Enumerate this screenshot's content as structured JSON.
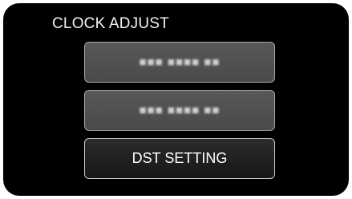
{
  "screen": {
    "title": "CLOCK ADJUST"
  },
  "menu": {
    "items": [
      {
        "label": "",
        "label_legible": false
      },
      {
        "label": "",
        "label_legible": false
      },
      {
        "label": "DST SETTING",
        "label_legible": true
      }
    ]
  },
  "colors": {
    "background": "#000000",
    "button_fill": "#525252",
    "button_border": "#a6a6a6",
    "text": "#ffffff"
  }
}
